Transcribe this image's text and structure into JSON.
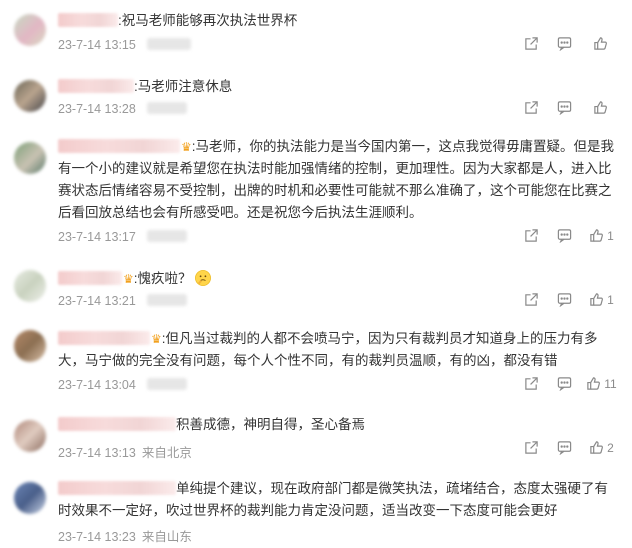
{
  "comments": [
    {
      "text": ":祝马老师能够再次执法世界杯",
      "time": "23-7-14 13:15",
      "location": "",
      "likes": "",
      "avatar_colors": [
        "#c7d9c3",
        "#e2b7c4",
        "#d9d9c2"
      ]
    },
    {
      "text": ":马老师注意休息",
      "time": "23-7-14 13:28",
      "location": "",
      "likes": "",
      "avatar_colors": [
        "#6b6657",
        "#b9a48e",
        "#45454a"
      ]
    },
    {
      "text": ":马老师，你的执法能力是当今国内第一，这点我觉得毋庸置疑。但是我有一个小的建议就是希望您在执法时能加强情绪的控制，更加理性。因为大家都是人，进入比赛状态后情绪容易不受控制，出牌的时机和必要性可能就不那么准确了，这个可能您在比赛之后看回放总结也会有所感受吧。还是祝您今后执法生涯顺利。",
      "time": "23-7-14 13:17",
      "location": "",
      "likes": "1",
      "avatar_colors": [
        "#7fa07a",
        "#c8c2b2",
        "#5a7a6a"
      ]
    },
    {
      "text": ":愧疚啦？",
      "time": "23-7-14 13:21",
      "location": "",
      "likes": "1",
      "avatar_colors": [
        "#e7ebe2",
        "#c9d2bf",
        "#eef0ea"
      ]
    },
    {
      "text": ":但凡当过裁判的人都不会喷马宁，因为只有裁判员才知道身上的压力有多大，马宁做的完全没有问题，每个人个性不同，有的裁判员温顺，有的凶，都没有错",
      "time": "23-7-14 13:04",
      "location": "",
      "likes": "11",
      "avatar_colors": [
        "#b58a6a",
        "#8c6f52",
        "#d9c0a8"
      ]
    },
    {
      "text": "积善成德，神明自得，圣心备焉",
      "time": "23-7-14 13:13",
      "location": "来自北京",
      "likes": "2",
      "avatar_colors": [
        "#b08a7c",
        "#e0cbc0",
        "#8c6d60"
      ]
    },
    {
      "text": "单纯提个建议，现在政府部门都是微笑执法，疏堵结合，态度太强硬了有时效果不一定好，吹过世界杯的裁判能力肯定没问题，适当改变一下态度可能会更好",
      "time": "23-7-14 13:23",
      "location": "来自山东",
      "likes": "",
      "avatar_colors": [
        "#6b86b6",
        "#4a5f8a",
        "#c9d3e6"
      ]
    }
  ],
  "icons": {
    "share": "share-icon",
    "reply": "comment-icon",
    "like": "thumbs-up-icon",
    "crown": "crown-icon",
    "emoji": "thinking-emoji"
  }
}
